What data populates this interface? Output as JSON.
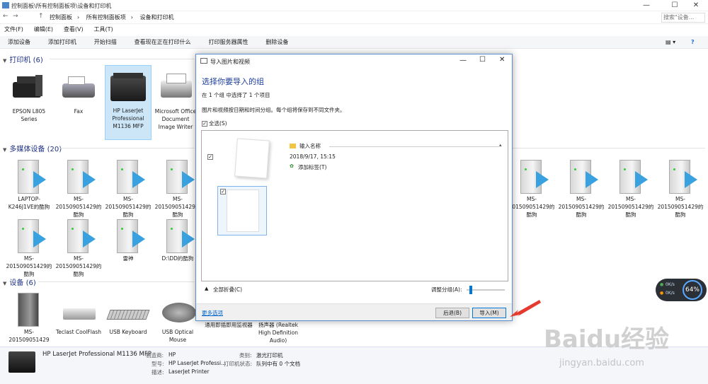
{
  "window": {
    "title": "控制面板\\所有控制面板项\\设备和打印机",
    "minimize": "—",
    "maximize": "☐",
    "close": "✕"
  },
  "address": {
    "crumbs": [
      "控制面板",
      "所有控制面板项",
      "设备和打印机"
    ],
    "search_placeholder": "搜索\"设备...",
    "back": "←",
    "forward": "→",
    "up": "↑"
  },
  "menu": [
    "文件(F)",
    "编辑(E)",
    "查看(V)",
    "工具(T)"
  ],
  "commands": [
    "添加设备",
    "添加打印机",
    "开始扫描",
    "查看现在正在打印什么",
    "打印服务器属性",
    "删除设备"
  ],
  "sections": {
    "printers": {
      "label": "打印机 (6)",
      "items": [
        "EPSON L805 Series",
        "Fax",
        "HP LaserJet Professional M1136 MFP",
        "Microsoft Office Document Image Writer"
      ]
    },
    "multimedia": {
      "label": "多媒体设备 (20)",
      "row1": [
        "LAPTOP-K246J1VE的酷狗",
        "MS-201509051429的酷狗",
        "MS-201509051429的酷狗",
        "MS-201509051429的酷狗",
        "MS-201509051429的酷狗",
        "MS-201509051429的酷狗",
        "MS-201509051429的酷狗",
        "MS-201509051429的酷狗"
      ],
      "row2": [
        "MS-201509051429的酷狗",
        "MS-201509051429的酷狗",
        "雷神",
        "D:\\DD的酷狗"
      ]
    },
    "devices": {
      "label": "设备 (6)",
      "items": [
        "MS-201509051429",
        "Teclast CoolFlash",
        "USB Keyboard",
        "USB Optical Mouse",
        "通用即插即用监视器",
        "扬声器 (Realtek High Definition Audio)"
      ]
    }
  },
  "dialog": {
    "title": "导入图片和视频",
    "heading": "选择你要导入的组",
    "info1": "在 1 个组 中选择了 1 个项目",
    "info2": "图片和视频按日期和时间分组。每个组将保存到不同文件夹。",
    "select_all": "全选(S)",
    "group": {
      "name": "输入名称",
      "date": "2018/9/17, 15:15",
      "tag": "添加标签(T)"
    },
    "collapse": "全部折叠(C)",
    "adjust": "调整分组(A):",
    "slider_level": 0.08,
    "more": "更多选项",
    "back_btn": "后退(B)",
    "import_btn": "导入(M)"
  },
  "details": {
    "name": "HP LaserJet Professional M1136 MFP",
    "manufacturer_key": "制造商:",
    "manufacturer": "HP",
    "model_key": "型号:",
    "model": "HP LaserJet Professi...",
    "desc_key": "描述:",
    "desc": "LaserJet Printer",
    "category_key": "类别:",
    "category": "激光打印机",
    "status_key": "打印机状态:",
    "status": "队列中有 0 个文档"
  },
  "gauge": {
    "percent": "64%",
    "up": "0K/s",
    "down": "0K/s"
  },
  "watermark": {
    "brand": "Baidu经验",
    "url": "jingyan.baidu.com"
  },
  "colors": {
    "accent": "#1e3e9b",
    "arrow": "#e53b2f",
    "media_play": "#3aa1e0"
  }
}
